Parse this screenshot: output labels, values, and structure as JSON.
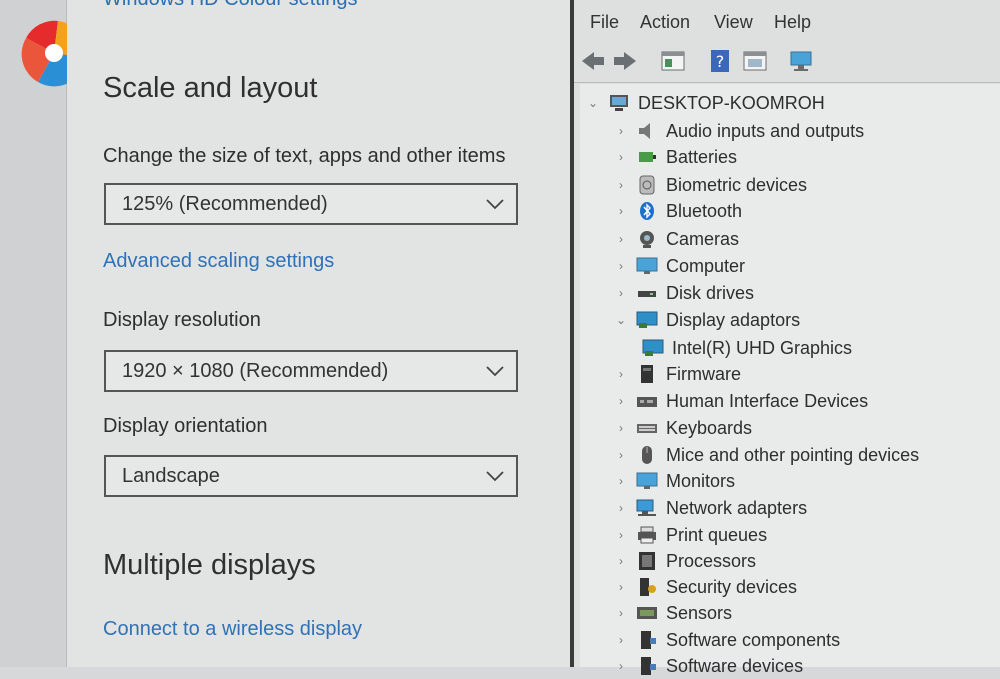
{
  "settings": {
    "top_link": "Windows HD Colour settings",
    "scale_title": "Scale and layout",
    "scale_label": "Change the size of text, apps and other items",
    "scale_value": "125% (Recommended)",
    "advanced_link": "Advanced scaling settings",
    "resolution_label": "Display resolution",
    "resolution_value": "1920 × 1080 (Recommended)",
    "orientation_label": "Display orientation",
    "orientation_value": "Landscape",
    "multiple_title": "Multiple displays",
    "wireless_link": "Connect to a wireless display"
  },
  "devmgr": {
    "menu": [
      "File",
      "Action",
      "View",
      "Help"
    ],
    "root": "DESKTOP-KOOMROH",
    "categories": [
      "Audio inputs and outputs",
      "Batteries",
      "Biometric devices",
      "Bluetooth",
      "Cameras",
      "Computer",
      "Disk drives",
      "Display adaptors",
      "Intel(R) UHD Graphics",
      "Firmware",
      "Human Interface Devices",
      "Keyboards",
      "Mice and other pointing devices",
      "Monitors",
      "Network adapters",
      "Print queues",
      "Processors",
      "Security devices",
      "Sensors",
      "Software components",
      "Software devices"
    ]
  }
}
